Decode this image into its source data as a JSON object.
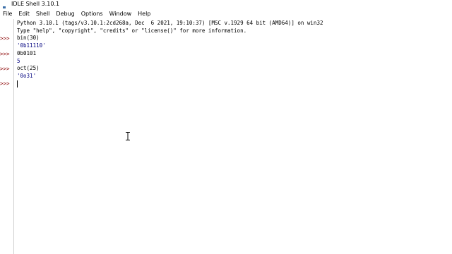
{
  "window": {
    "title": "IDLE Shell 3.10.1"
  },
  "menu": {
    "items": [
      "File",
      "Edit",
      "Shell",
      "Debug",
      "Options",
      "Window",
      "Help"
    ]
  },
  "shell": {
    "prompt": ">>>",
    "banner_line1": "Python 3.10.1 (tags/v3.10.1:2cd268a, Dec  6 2021, 19:10:37) [MSC v.1929 64 bit (AMD64)] on win32",
    "banner_line2": "Type \"help\", \"copyright\", \"credits\" or \"license()\" for more information.",
    "entries": [
      {
        "input": "bin(30)",
        "output": "'0b11110'"
      },
      {
        "input": "0b0101",
        "output": "5"
      },
      {
        "input": "oct(25)",
        "output": "'0o31'"
      }
    ]
  },
  "colors": {
    "prompt": "#8b0000",
    "result": "#00007f",
    "text": "#000000"
  }
}
